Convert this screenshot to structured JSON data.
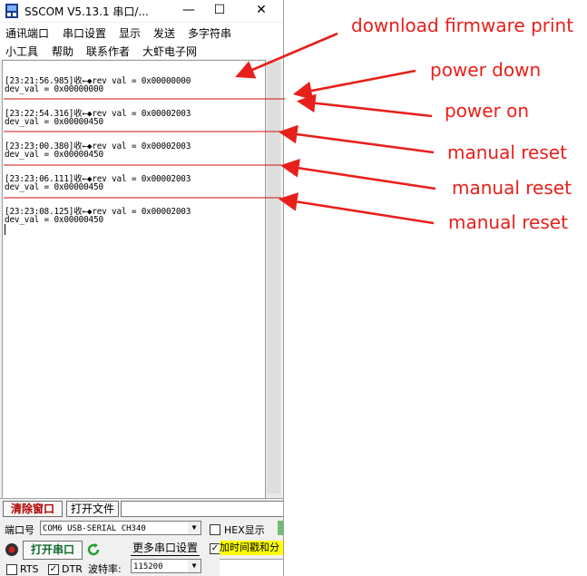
{
  "window": {
    "title": "SSCOM V5.13.1 串口/...",
    "minimize_glyph": "—",
    "maximize_glyph": "☐",
    "close_glyph": "✕"
  },
  "menu": {
    "row1": [
      "通讯端口",
      "串口设置",
      "显示",
      "发送",
      "多字符串"
    ],
    "row2": [
      "小工具",
      "帮助",
      "联系作者",
      "大虾电子网"
    ]
  },
  "log": [
    "[23:21:56.985]收←◆rev val = 0x00000000",
    "dev_val = 0x00000000",
    "[23:22:54.316]收←◆rev val = 0x00002003",
    "dev_val = 0x00000450",
    "[23:23:00.380]收←◆rev val = 0x00002003",
    "dev_val = 0x00000450",
    "[23:23:06.111]收←◆rev val = 0x00002003",
    "dev_val = 0x00000450",
    "[23:23:08.125]收←◆rev val = 0x00002003",
    "dev_val = 0x00000450"
  ],
  "bottom": {
    "clear_button": "清除窗口",
    "open_file_button": "打开文件",
    "file_path": "",
    "port_label": "端口号",
    "port_value": "COM6 USB-SERIAL CH340",
    "hex_display_label": "HEX显示",
    "open_port_button": "打开串口",
    "more_settings_button": "更多串口设置",
    "timestamp_label": "加时间戳和分",
    "rts_label": "RTS",
    "dtr_label": "DTR",
    "baud_label": "波特率:",
    "baud_value": "115200"
  },
  "annotations": [
    "download firmware print",
    "power down",
    "power on",
    "manual reset",
    "manual reset",
    "manual reset"
  ],
  "colors": {
    "annotation": "#e8201b",
    "separator": "#d01010",
    "timestamp_highlight": "#ffff00",
    "clear_button_text": "#b00000"
  }
}
